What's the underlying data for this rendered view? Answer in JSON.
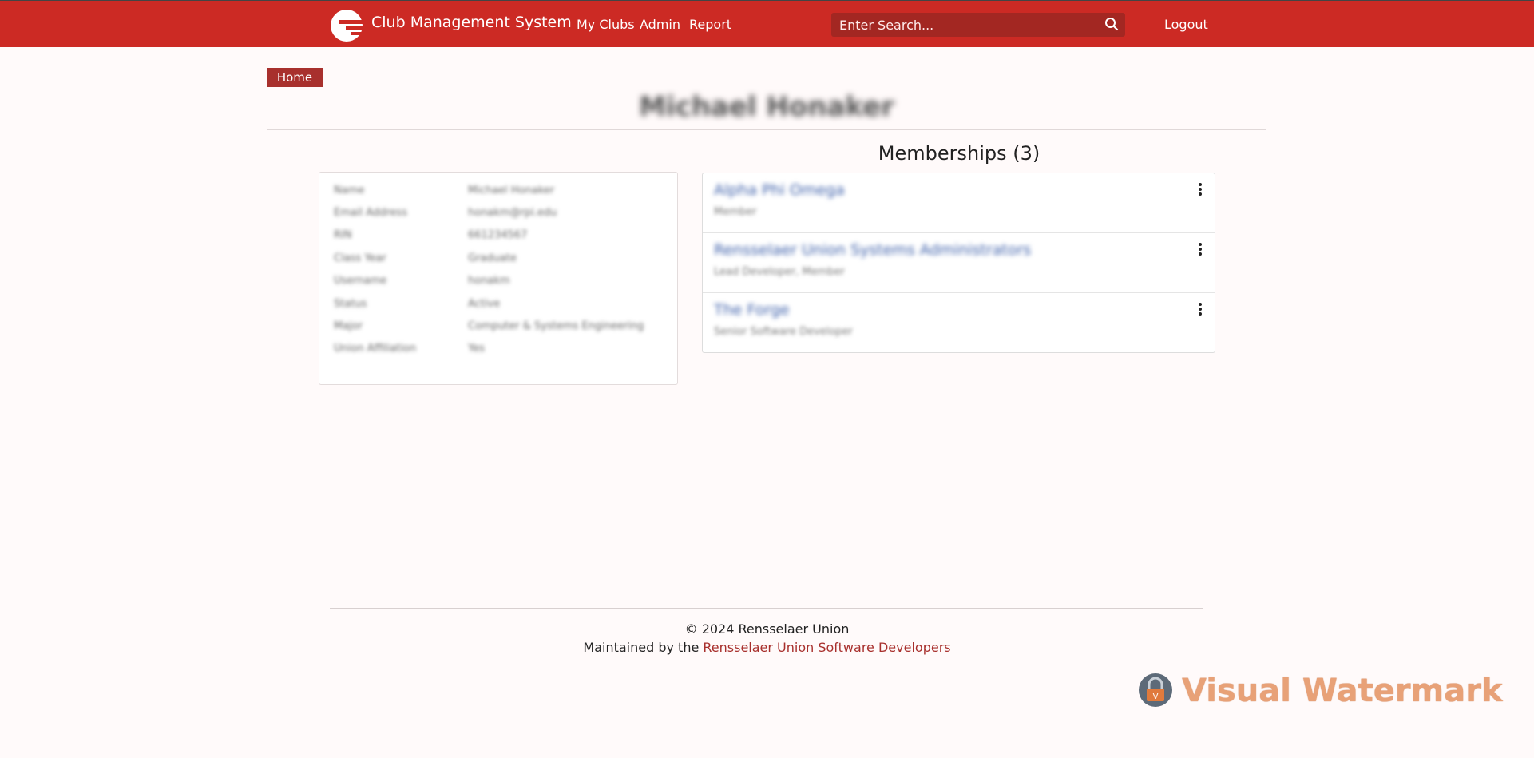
{
  "header": {
    "title": "Club Management System",
    "nav": [
      "My Clubs",
      "Admin",
      "Report"
    ],
    "search_placeholder": "Enter Search...",
    "logout": "Logout",
    "brand_color": "#cc2a24"
  },
  "breadcrumb": {
    "home": "Home"
  },
  "profile": {
    "name": "Michael Honaker",
    "fields": [
      {
        "label": "Name",
        "value": "Michael Honaker"
      },
      {
        "label": "Email Address",
        "value": "honakm@rpi.edu"
      },
      {
        "label": "RIN",
        "value": "661234567"
      },
      {
        "label": "Class Year",
        "value": "Graduate"
      },
      {
        "label": "Username",
        "value": "honakm"
      },
      {
        "label": "Status",
        "value": "Active"
      },
      {
        "label": "Major",
        "value": "Computer & Systems Engineering"
      },
      {
        "label": "Union Affiliation",
        "value": "Yes"
      }
    ]
  },
  "memberships": {
    "heading": "Memberships (3)",
    "items": [
      {
        "name": "Alpha Phi Omega",
        "role": "Member"
      },
      {
        "name": "Rensselaer Union Systems Administrators",
        "role": "Lead Developer, Member"
      },
      {
        "name": "The Forge",
        "role": "Senior Software Developer"
      }
    ]
  },
  "footer": {
    "copyright": "© 2024 Rensselaer Union",
    "maintained_prefix": "Maintained by the ",
    "maintained_link": "Rensselaer Union Software Developers"
  },
  "watermark": {
    "text": "Visual Watermark"
  }
}
